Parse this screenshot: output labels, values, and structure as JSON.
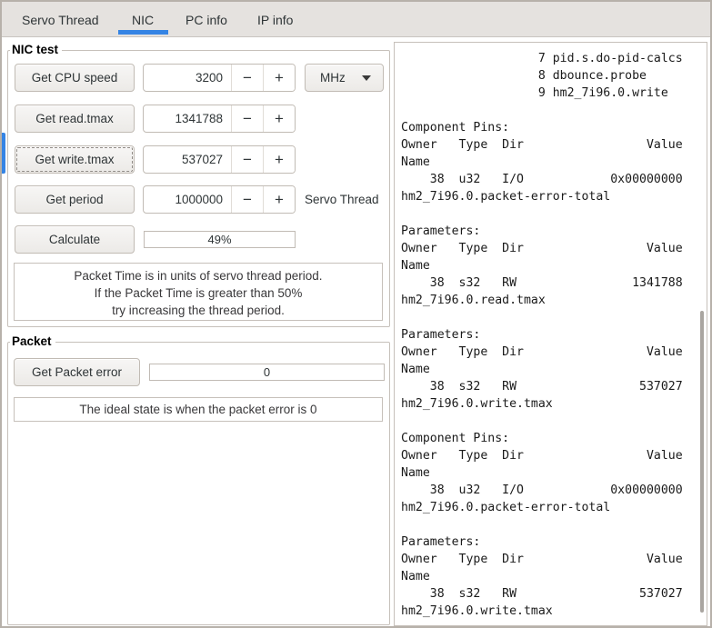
{
  "colors": {
    "accent": "#3584e4",
    "tabbar_bg": "#e5e2df",
    "border": "#c1bbb4"
  },
  "icons": {
    "minus": "−",
    "plus": "+",
    "dropdown": "dropdown-arrow"
  },
  "tabs": {
    "items": [
      {
        "label": "Servo Thread",
        "active": false
      },
      {
        "label": "NIC",
        "active": true
      },
      {
        "label": "PC info",
        "active": false
      },
      {
        "label": "IP info",
        "active": false
      }
    ]
  },
  "nic_test": {
    "title": "NIC test",
    "rows": [
      {
        "button": "Get CPU speed",
        "value": "3200",
        "unit": "MHz"
      },
      {
        "button": "Get read.tmax",
        "value": "1341788"
      },
      {
        "button": "Get write.tmax",
        "value": "537027"
      },
      {
        "button": "Get period",
        "value": "1000000",
        "label": "Servo Thread"
      }
    ],
    "calculate_button": "Calculate",
    "progress_value": "49%",
    "note_lines": [
      "Packet Time is in units of servo thread period.",
      "If the Packet Time is greater than 50%",
      "try increasing the thread period."
    ]
  },
  "packet": {
    "title": "Packet",
    "button": "Get Packet error",
    "value": "0",
    "note": "The ideal state is when the packet error is 0"
  },
  "output": {
    "text": "                   7 pid.s.do-pid-calcs\n                   8 dbounce.probe\n                   9 hm2_7i96.0.write\n\nComponent Pins:\nOwner   Type  Dir                 Value\nName\n    38  u32   I/O            0x00000000\nhm2_7i96.0.packet-error-total\n\nParameters:\nOwner   Type  Dir                 Value\nName\n    38  s32   RW                1341788\nhm2_7i96.0.read.tmax\n\nParameters:\nOwner   Type  Dir                 Value\nName\n    38  s32   RW                 537027\nhm2_7i96.0.write.tmax\n\nComponent Pins:\nOwner   Type  Dir                 Value\nName\n    38  u32   I/O            0x00000000\nhm2_7i96.0.packet-error-total\n\nParameters:\nOwner   Type  Dir                 Value\nName\n    38  s32   RW                 537027\nhm2_7i96.0.write.tmax"
  }
}
